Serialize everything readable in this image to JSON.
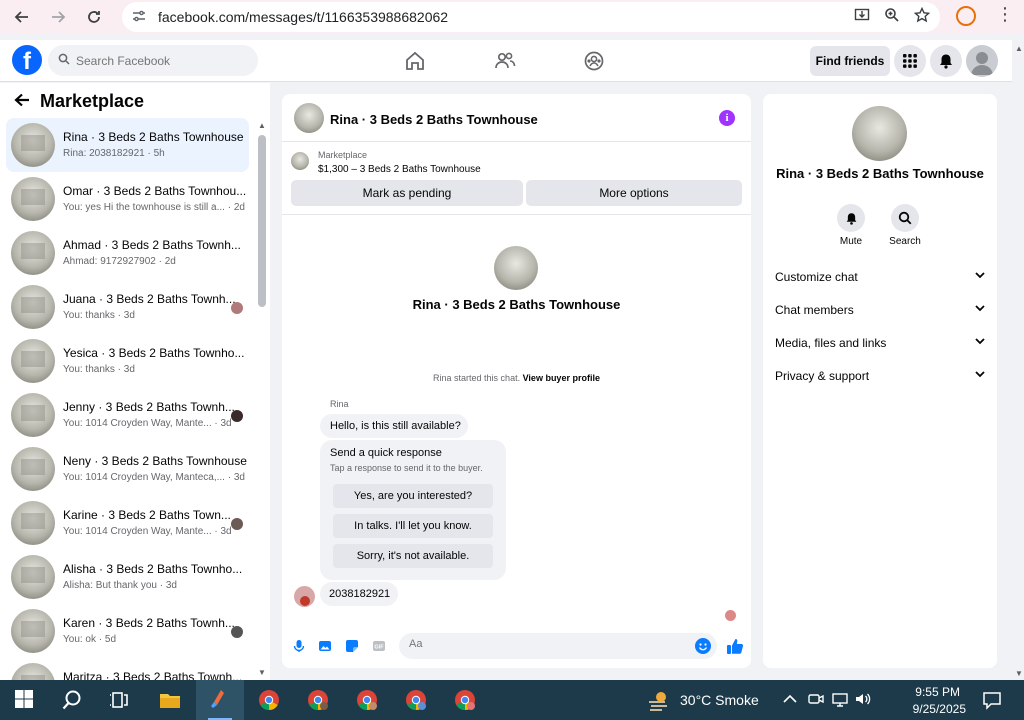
{
  "browser": {
    "url": "facebook.com/messages/t/1166353988682062"
  },
  "fb_header": {
    "search_placeholder": "Search Facebook",
    "find_friends": "Find friends"
  },
  "left": {
    "title": "Marketplace",
    "conversations": [
      {
        "name": "Rina · 3 Beds 2 Baths Townhouse",
        "preview": "Rina: 2038182921 · 5h",
        "active": true
      },
      {
        "name": "Omar · 3 Beds 2 Baths Townhou...",
        "preview": "You: yes Hi the townhouse is still a... · 2d"
      },
      {
        "name": "Ahmad · 3 Beds 2 Baths Townh...",
        "preview": "Ahmad: 9172927902 · 2d"
      },
      {
        "name": "Juana · 3 Beds 2 Baths Townh...",
        "preview": "You: thanks · 3d"
      },
      {
        "name": "Yesica · 3 Beds 2 Baths Townho...",
        "preview": "You: thanks · 3d"
      },
      {
        "name": "Jenny · 3 Beds 2 Baths Townh...",
        "preview": "You: 1014 Croyden Way, Mante... · 3d"
      },
      {
        "name": "Neny · 3 Beds 2 Baths Townhouse",
        "preview": "You: 1014 Croyden Way, Manteca,... · 3d"
      },
      {
        "name": "Karine · 3 Beds 2 Baths Town...",
        "preview": "You: 1014 Croyden Way, Mante... · 3d"
      },
      {
        "name": "Alisha · 3 Beds 2 Baths Townho...",
        "preview": "Alisha: But thank you · 3d"
      },
      {
        "name": "Karen · 3 Beds 2 Baths Townh...",
        "preview": "You: ok · 5d"
      },
      {
        "name": "Maritza · 3 Beds 2 Baths Townh...",
        "preview": ""
      }
    ]
  },
  "chat": {
    "title": "Rina · 3 Beds 2 Baths Townhouse",
    "listing_source": "Marketplace",
    "listing_price": "$1,300 – 3 Beds 2 Baths Townhouse",
    "mark_pending": "Mark as pending",
    "more_options": "More options",
    "center_name": "Rina · 3 Beds 2 Baths Townhouse",
    "started_text": "Rina started this chat.",
    "view_profile": "View buyer profile",
    "sender": "Rina",
    "msg1": "Hello, is this still available?",
    "quick_title": "Send a quick response",
    "quick_sub": "Tap a response to send it to the buyer.",
    "quick_responses": [
      "Yes, are you interested?",
      "In talks. I'll let you know.",
      "Sorry, it's not available."
    ],
    "msg2": "2038182921",
    "composer_placeholder": "Aa"
  },
  "right": {
    "name": "Rina · 3 Beds 2 Baths Townhouse",
    "mute": "Mute",
    "search": "Search",
    "rows": [
      "Customize chat",
      "Chat members",
      "Media, files and links",
      "Privacy & support"
    ]
  },
  "taskbar": {
    "weather": "30°C Smoke",
    "time": "9:55 PM",
    "date": "9/25/2025"
  },
  "colors": {
    "fb_blue": "#0866ff",
    "info_purple": "#a033ff",
    "active_row": "#ebf3ff",
    "taskbar": "#1c3a4a"
  }
}
